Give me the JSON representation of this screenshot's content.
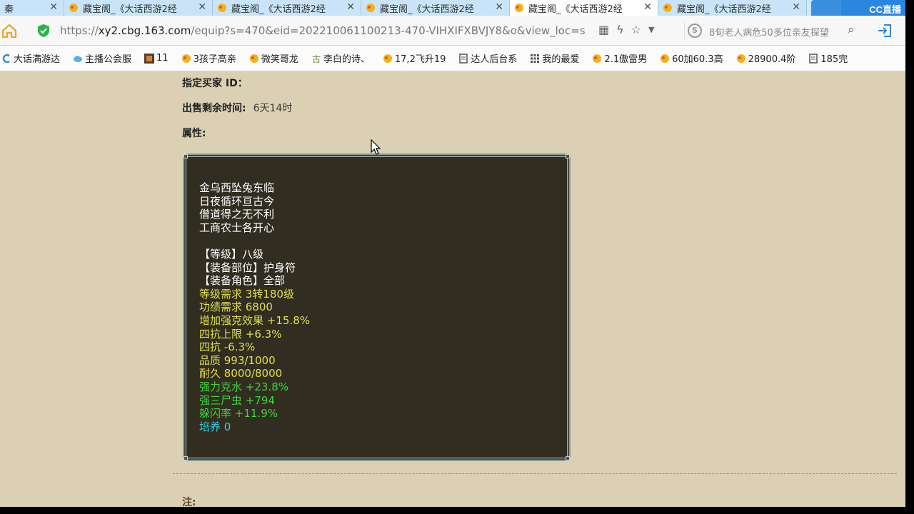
{
  "tabs": [
    {
      "label": "秦",
      "active": false
    },
    {
      "label": "藏宝阁_《大话西游2经",
      "active": false
    },
    {
      "label": "藏宝阁_《大话西游2经",
      "active": false
    },
    {
      "label": "藏宝阁_《大话西游2经",
      "active": false
    },
    {
      "label": "藏宝阁_《大话西游2经",
      "active": true
    },
    {
      "label": "藏宝阁_《大话西游2经",
      "active": false
    }
  ],
  "brand": "CC直播",
  "address": {
    "protocol": "https://",
    "host": "xy2.cbg.163.com",
    "path": "/equip?s=470&eid=202210061100213-470-VIHXIFXBVJY8&o&view_loc=s",
    "search_text": "8旬老人病危50多位亲友探望"
  },
  "bookmarks": [
    "大话满游达",
    "主播公会服",
    "11",
    "3孩子高亲",
    "微笑哥龙",
    "李白的诗、",
    "17,2飞升19",
    "达人后台系",
    "我的最爱",
    "2.1傲雷男",
    "60加60.3高",
    "28900.4阶",
    "185完"
  ],
  "fields": {
    "buyer_label": "指定买家 ID：",
    "time_label": "出售剩余时间:",
    "time_value": "6天14时",
    "attr_label": "属性:"
  },
  "tooltip": {
    "poem": [
      "金乌西坠兔东临",
      "日夜循环亘古今",
      "僧道得之无不利",
      "工商农士各开心"
    ],
    "base": [
      "【等级】八级",
      "【装备部位】护身符",
      "【装备角色】全部"
    ],
    "requirements": [
      "等级需求 3转180级",
      "功绩需求 6800"
    ],
    "stats": [
      "增加强克效果 +15.8%",
      "四抗上限 +6.3%",
      "四抗 -6.3%",
      "品质 993/1000",
      "耐久 8000/8000"
    ],
    "special": [
      "强力克水 +23.8%",
      "强三尸虫 +794",
      "躲闪率 +11.9%"
    ],
    "culture": "培养 0"
  },
  "note_label": "注:",
  "colors": {
    "white": "#ffffff",
    "yellow": "#e4df4e",
    "green": "#3ed33a",
    "cyan": "#33d3e8",
    "panel": "#312e21",
    "page": "#dcd0b4"
  }
}
